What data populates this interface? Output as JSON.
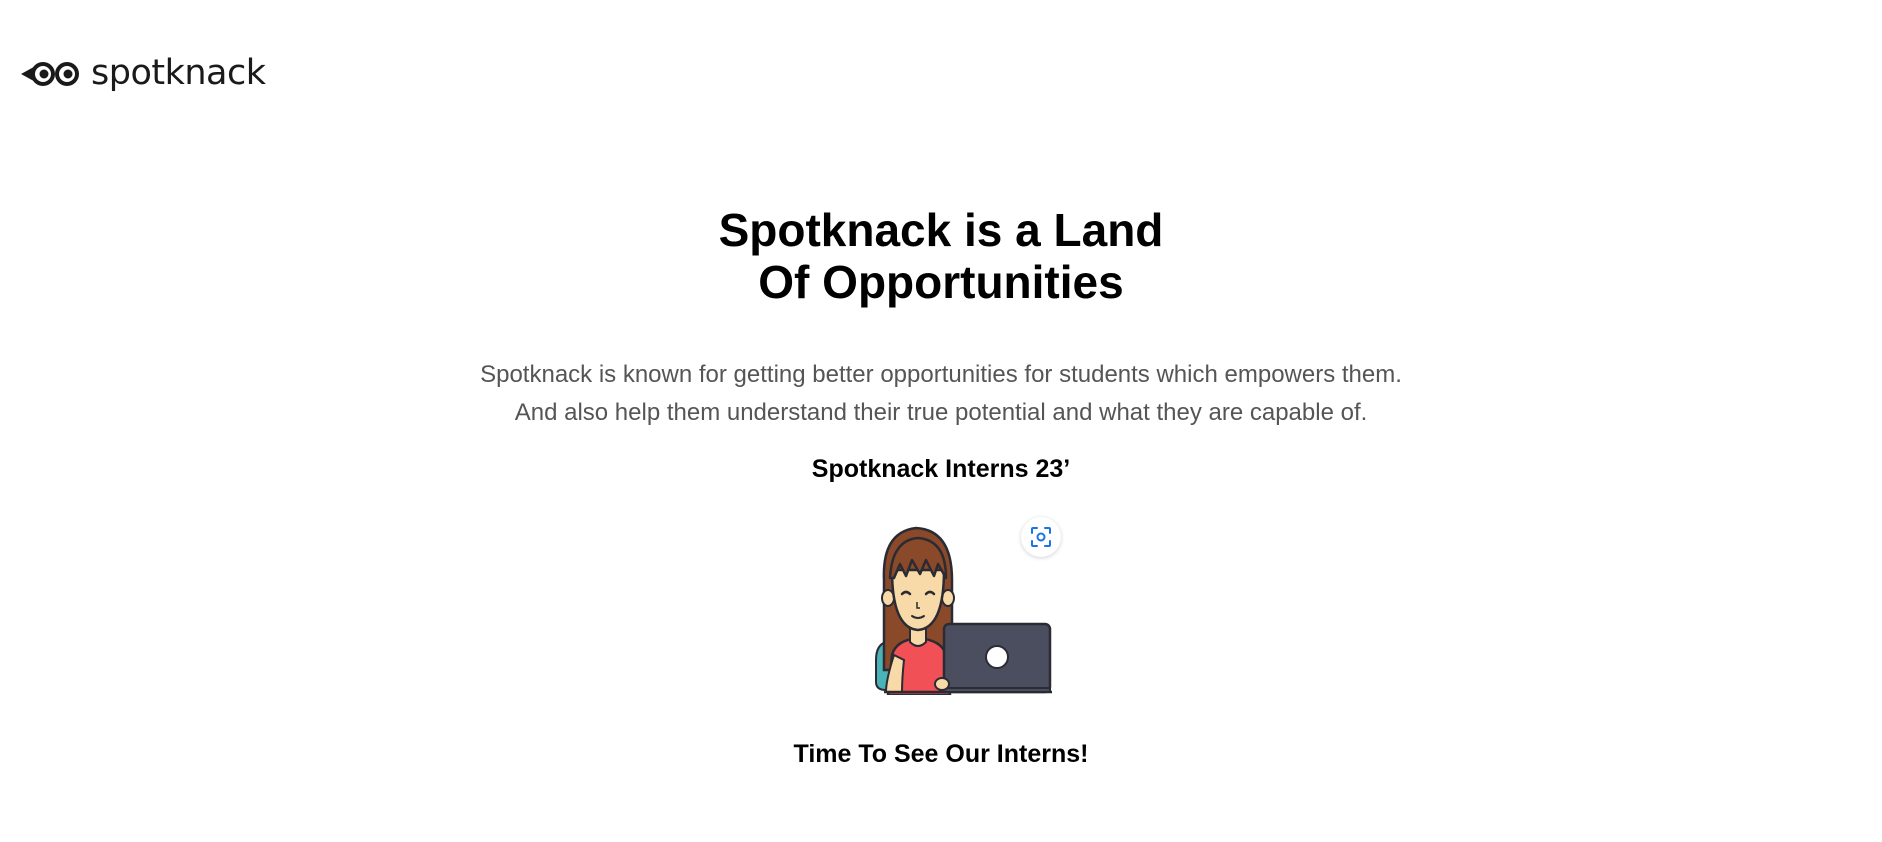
{
  "header": {
    "logo_text": "spotknack",
    "logo_icon": "eyes-logo-icon"
  },
  "hero": {
    "title_line1": "Spotknack is a Land",
    "title_line2": "Of Opportunities",
    "description_line1": "Spotknack is known for getting better opportunities for students which empowers them.",
    "description_line2": "And also help them understand their true potential and what they are capable of."
  },
  "interns": {
    "heading": "Spotknack Interns 23’",
    "illustration": "intern-with-laptop-illustration",
    "lens_icon": "visual-search-icon",
    "cta": "Time To See Our Interns!"
  },
  "colors": {
    "title": "#000000",
    "description": "#555555",
    "shirt": "#f05056",
    "laptop": "#4a4e5e",
    "hair": "#8a4a2a",
    "skin": "#f8d9a8"
  }
}
